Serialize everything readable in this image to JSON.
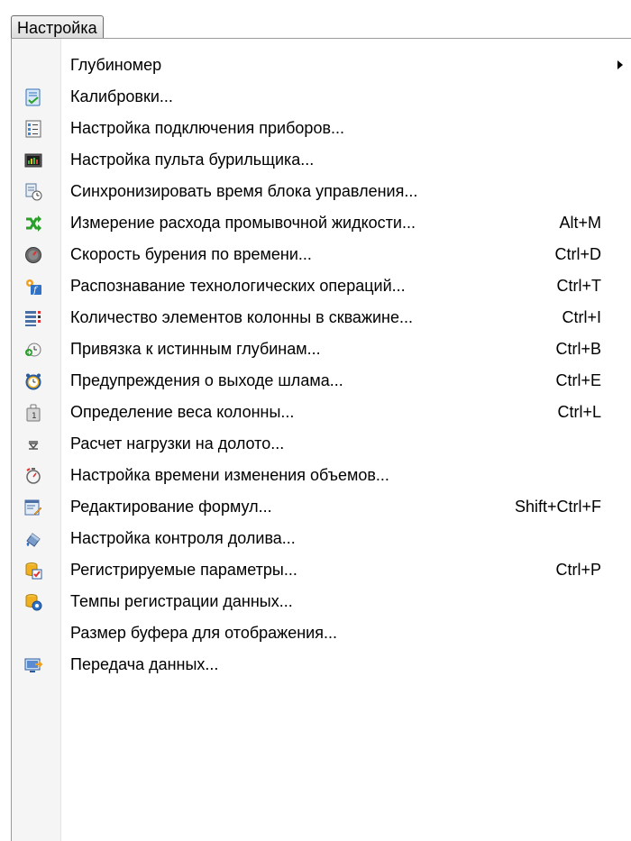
{
  "menu": {
    "title": "Настройка"
  },
  "items": [
    {
      "label": "Глубиномер",
      "shortcut": "",
      "icon": "none",
      "submenu": true
    },
    {
      "label": "Калибровки...",
      "shortcut": "",
      "icon": "checklist-icon"
    },
    {
      "label": "Настройка подключения приборов...",
      "shortcut": "",
      "icon": "device-connection-icon"
    },
    {
      "label": "Настройка пульта бурильщика...",
      "shortcut": "",
      "icon": "driller-console-icon"
    },
    {
      "label": "Синхронизировать время блока управления...",
      "shortcut": "",
      "icon": "sync-clock-icon"
    },
    {
      "label": "Измерение расхода промывочной жидкости...",
      "shortcut": "Alt+M",
      "icon": "shuffle-arrows-icon"
    },
    {
      "label": "Скорость бурения по времени...",
      "shortcut": "Ctrl+D",
      "icon": "speedometer-icon"
    },
    {
      "label": "Распознавание технологических операций...",
      "shortcut": "Ctrl+T",
      "icon": "function-recognition-icon"
    },
    {
      "label": "Количество элементов колонны в скважине...",
      "shortcut": "Ctrl+I",
      "icon": "column-elements-icon"
    },
    {
      "label": "Привязка к истинным глубинам...",
      "shortcut": "Ctrl+B",
      "icon": "depth-link-icon"
    },
    {
      "label": "Предупреждения о выходе шлама...",
      "shortcut": "Ctrl+E",
      "icon": "alarm-clock-icon"
    },
    {
      "label": "Определение веса колонны...",
      "shortcut": "Ctrl+L",
      "icon": "weight-icon"
    },
    {
      "label": "Расчет нагрузки на долото...",
      "shortcut": "",
      "icon": "load-icon"
    },
    {
      "label": "Настройка времени изменения объемов...",
      "shortcut": "",
      "icon": "timer-icon"
    },
    {
      "label": "Редактирование формул...",
      "shortcut": "Shift+Ctrl+F",
      "icon": "edit-formula-icon"
    },
    {
      "label": "Настройка контроля долива...",
      "shortcut": "",
      "icon": "fill-control-icon"
    },
    {
      "label": "Регистрируемые параметры...",
      "shortcut": "Ctrl+P",
      "icon": "db-checklist-icon"
    },
    {
      "label": "Темпы регистрации данных...",
      "shortcut": "",
      "icon": "db-settings-icon"
    },
    {
      "label": "Размер буфера для отображения...",
      "shortcut": "",
      "icon": "none"
    },
    {
      "label": "Передача данных...",
      "shortcut": "",
      "icon": "data-transfer-icon"
    }
  ]
}
